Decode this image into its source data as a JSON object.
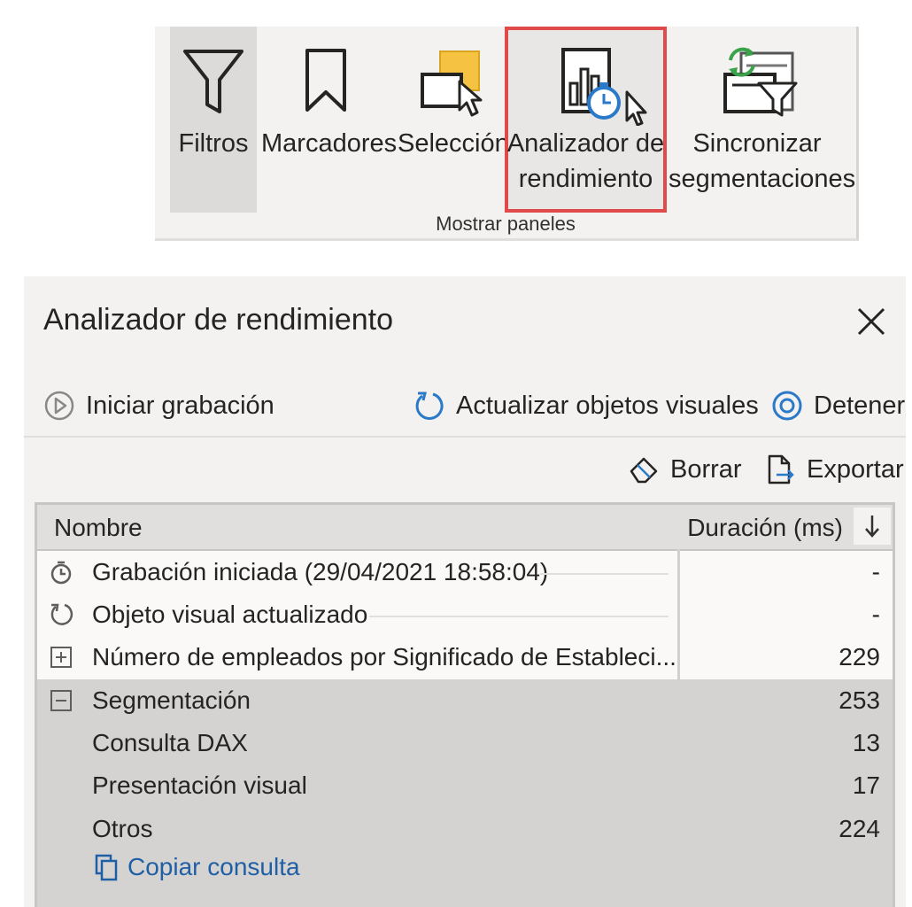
{
  "ribbon": {
    "buttons": [
      {
        "label": "Filtros",
        "icon": "filter-icon"
      },
      {
        "label": "Marcadores",
        "icon": "bookmark-icon"
      },
      {
        "label": "Selección",
        "icon": "selection-icon"
      },
      {
        "label_line1": "Analizador de",
        "label_line2": "rendimiento",
        "icon": "performance-analyzer-icon"
      },
      {
        "label_line1": "Sincronizar",
        "label_line2": "segmentaciones",
        "icon": "sync-slicers-icon"
      }
    ],
    "group_label": "Mostrar paneles"
  },
  "pane": {
    "title": "Analizador de rendimiento",
    "toolbar": {
      "start": "Iniciar grabación",
      "refresh": "Actualizar objetos visuales",
      "stop": "Detener",
      "clear": "Borrar",
      "export": "Exportar"
    },
    "table": {
      "col_name": "Nombre",
      "col_duration": "Duración (ms)",
      "rows": [
        {
          "name": "Grabación iniciada (29/04/2021 18:58:04)",
          "duration": "-",
          "icon": "stopwatch-icon"
        },
        {
          "name": "Objeto visual actualizado",
          "duration": "-",
          "icon": "refresh-icon"
        },
        {
          "name": "Número de empleados por Significado de Estableci...",
          "duration": "229",
          "icon": "expand-icon"
        },
        {
          "name": "Segmentación",
          "duration": "253",
          "icon": "collapse-icon"
        },
        {
          "name": "Consulta DAX",
          "duration": "13"
        },
        {
          "name": "Presentación visual",
          "duration": "17"
        },
        {
          "name": "Otros",
          "duration": "224"
        }
      ],
      "copy_query": "Copiar consulta"
    }
  },
  "colors": {
    "highlight": "#e04a4a",
    "link": "#1f5fa6",
    "accent_yellow": "#f5c242",
    "sync_green": "#3aa34a",
    "stopwatch_blue": "#2b79c9"
  }
}
